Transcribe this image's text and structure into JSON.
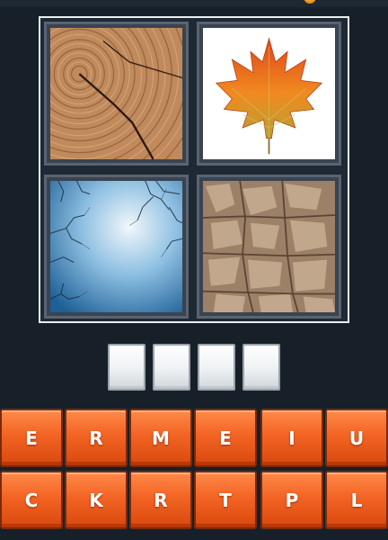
{
  "board": {
    "images": [
      {
        "id": "img1",
        "subject": "tree-rings"
      },
      {
        "id": "img2",
        "subject": "maple-leaf"
      },
      {
        "id": "img3",
        "subject": "bare-branches-sky"
      },
      {
        "id": "img4",
        "subject": "tree-bark"
      }
    ]
  },
  "answer": {
    "length": 4,
    "slots": [
      "",
      "",
      "",
      ""
    ]
  },
  "keyboard": {
    "rows": [
      [
        "E",
        "R",
        "M",
        "E",
        "I",
        "U"
      ],
      [
        "C",
        "K",
        "R",
        "T",
        "P",
        "L"
      ]
    ]
  },
  "colors": {
    "background": "#172029",
    "key": "#f26424",
    "key_border": "#7a2a0a",
    "slot": "#ffffff",
    "board_border": "#e9eef2"
  }
}
